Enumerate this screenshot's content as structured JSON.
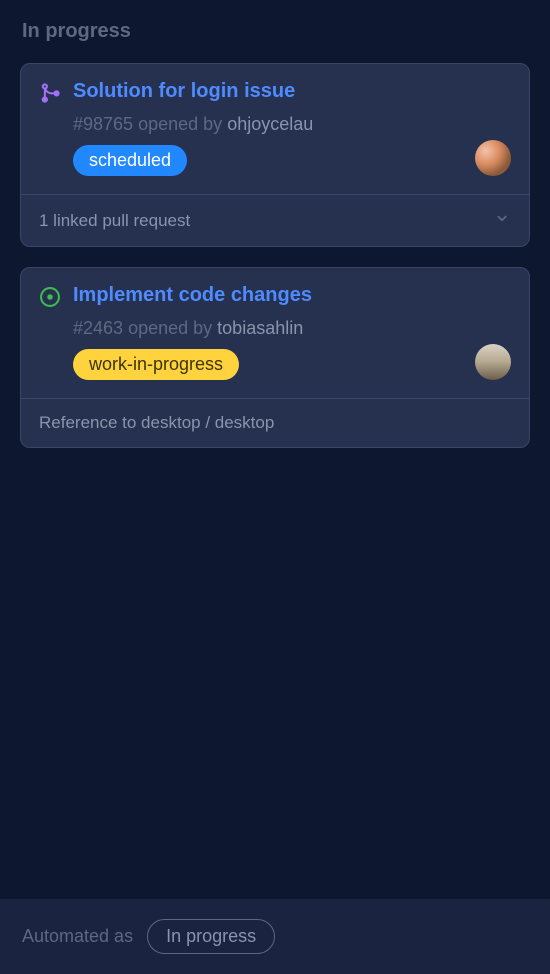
{
  "column": {
    "header": "In progress"
  },
  "cards": [
    {
      "title": "Solution for login issue",
      "issue_number": "#98765",
      "opened_text": "opened by",
      "author": "ohjoycelau",
      "label": "scheduled",
      "label_style": "blue",
      "icon": "pull-request",
      "footer": "1 linked pull request",
      "has_chevron": true
    },
    {
      "title": "Implement code changes",
      "issue_number": "#2463",
      "opened_text": "opened by",
      "author": "tobiasahlin",
      "label": "work-in-progress",
      "label_style": "yellow",
      "icon": "open-issue",
      "footer": "Reference to desktop / desktop",
      "has_chevron": false
    }
  ],
  "automation": {
    "prefix": "Automated as",
    "status": "In progress"
  }
}
